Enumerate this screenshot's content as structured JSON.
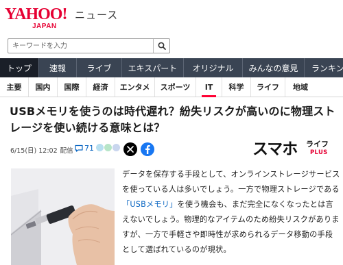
{
  "header": {
    "logo_main": "YAHOO!",
    "logo_sub": "JAPAN",
    "section": "ニュース"
  },
  "search": {
    "placeholder": "キーワードを入力",
    "icon": "search-icon"
  },
  "topnav": {
    "items": [
      {
        "label": "トップ",
        "active": true
      },
      {
        "label": "速報",
        "active": false
      },
      {
        "label": "ライブ",
        "active": false
      },
      {
        "label": "エキスパート",
        "active": false
      },
      {
        "label": "オリジナル",
        "active": false
      },
      {
        "label": "みんなの意見",
        "active": false
      },
      {
        "label": "ランキン",
        "active": false
      }
    ]
  },
  "catnav": {
    "items": [
      {
        "label": "主要",
        "active": false
      },
      {
        "label": "国内",
        "active": false
      },
      {
        "label": "国際",
        "active": false
      },
      {
        "label": "経済",
        "active": false
      },
      {
        "label": "エンタメ",
        "active": false
      },
      {
        "label": "スポーツ",
        "active": false
      },
      {
        "label": "IT",
        "active": true
      },
      {
        "label": "科学",
        "active": false
      },
      {
        "label": "ライフ",
        "active": false
      },
      {
        "label": "地域",
        "active": false
      }
    ]
  },
  "article": {
    "headline": "USBメモリを使うのは時代遅れ？紛失リスクが高いのに物理ストレージを使い続ける意味とは？",
    "date": "6/15(日) 12:02",
    "status": "配信",
    "comment_count": "71",
    "publisher_main": "スマホ",
    "publisher_sub": "ライフ",
    "publisher_plus": "PLUS",
    "body_before": "データを保存する手段として、オンラインストレージサービスを使っている人は多いでしょう。一方で物理ストレージである",
    "body_link": "「USBメモリ」",
    "body_after": "を使う機会も、まだ完全になくなったとは言えないでしょう。物理的なアイテムのため紛失リスクがありますが、一方で手軽さや即時性が求められるデータ移動の手段として選ばれているのが現状。"
  },
  "colors": {
    "brand": "#e60033",
    "nav_bg": "#3a4453",
    "link": "#0a66c2"
  }
}
